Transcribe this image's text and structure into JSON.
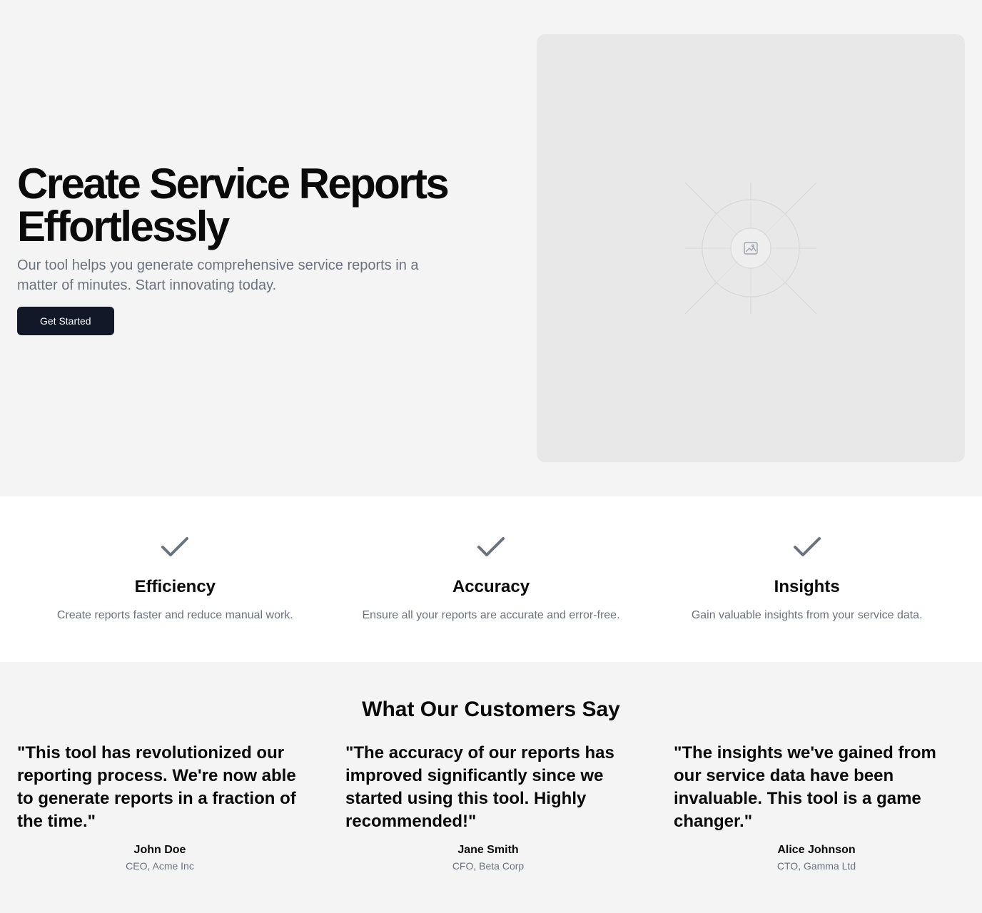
{
  "hero": {
    "title": "Create Service Reports Effortlessly",
    "subtitle": "Our tool helps you generate comprehensive service reports in a matter of minutes. Start innovating today.",
    "cta_label": "Get Started",
    "image_icon": "image-placeholder-icon"
  },
  "features": [
    {
      "icon": "check-icon",
      "title": "Efficiency",
      "description": "Create reports faster and reduce manual work."
    },
    {
      "icon": "check-icon",
      "title": "Accuracy",
      "description": "Ensure all your reports are accurate and error-free."
    },
    {
      "icon": "check-icon",
      "title": "Insights",
      "description": "Gain valuable insights from your service data."
    }
  ],
  "testimonials": {
    "title": "What Our Customers Say",
    "items": [
      {
        "quote": "\"This tool has revolutionized our reporting process. We're now able to generate reports in a fraction of the time.\"",
        "name": "John Doe",
        "role": "CEO, Acme Inc"
      },
      {
        "quote": "\"The accuracy of our reports has improved significantly since we started using this tool. Highly recommended!\"",
        "name": "Jane Smith",
        "role": "CFO, Beta Corp"
      },
      {
        "quote": "\"The insights we've gained from our service data have been invaluable. This tool is a game changer.\"",
        "name": "Alice Johnson",
        "role": "CTO, Gamma Ltd"
      }
    ]
  },
  "colors": {
    "background": "#f4f4f4",
    "feature_background": "#ffffff",
    "button": "#111827",
    "muted_text": "#6b7280",
    "placeholder": "#e8e8e8"
  }
}
